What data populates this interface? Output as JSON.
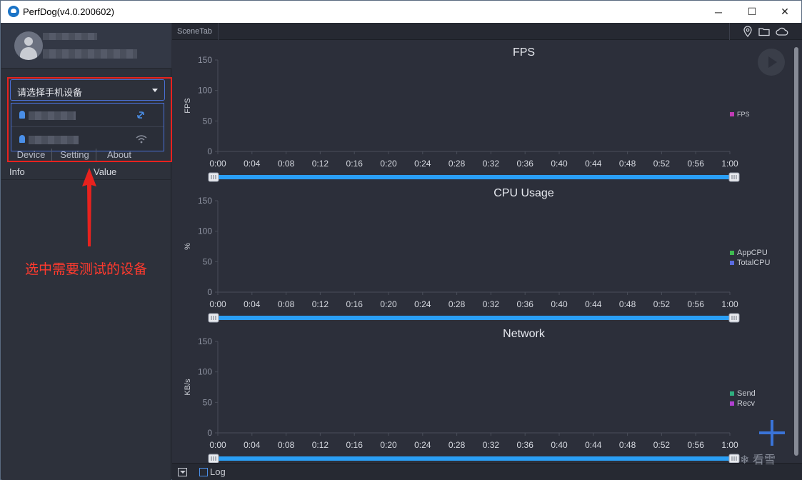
{
  "window": {
    "title": "PerfDog(v4.0.200602)",
    "minimize_glyph": "─",
    "maximize_glyph": "☐",
    "close_glyph": "✕"
  },
  "sidebar": {
    "device_select_placeholder": "请选择手机设备",
    "devices": [
      {
        "connection_icon": "usb-link-icon"
      },
      {
        "connection_icon": "wifi-icon"
      }
    ],
    "tabs": [
      "Device",
      "Setting",
      "About"
    ],
    "info_headers": {
      "info": "Info",
      "value": "Value"
    },
    "annotation": "选中需要测试的设备"
  },
  "scene": {
    "tab_label": "SceneTab",
    "toolbar_icons": [
      "location-pin-icon",
      "folder-icon",
      "cloud-icon"
    ]
  },
  "log": {
    "label": "Log"
  },
  "watermark": "看雪",
  "colors": {
    "accent": "#3a74d8",
    "slider": "#2a9ff5",
    "annotation": "#e8221e"
  },
  "chart_data": [
    {
      "type": "line",
      "title": "FPS",
      "ylabel": "FPS",
      "ylim": [
        0,
        150
      ],
      "yticks": [
        "150",
        "100",
        "50",
        "0"
      ],
      "x": [
        "0:00",
        "0:04",
        "0:08",
        "0:12",
        "0:16",
        "0:20",
        "0:24",
        "0:28",
        "0:32",
        "0:36",
        "0:40",
        "0:44",
        "0:48",
        "0:52",
        "0:56",
        "1:00"
      ],
      "series": [
        {
          "name": "FPS",
          "color": "#c23bb5",
          "values": []
        }
      ],
      "legend": "right"
    },
    {
      "type": "line",
      "title": "CPU Usage",
      "ylabel": "%",
      "ylim": [
        0,
        150
      ],
      "yticks": [
        "150",
        "100",
        "50",
        "0"
      ],
      "x": [
        "0:00",
        "0:04",
        "0:08",
        "0:12",
        "0:16",
        "0:20",
        "0:24",
        "0:28",
        "0:32",
        "0:36",
        "0:40",
        "0:44",
        "0:48",
        "0:52",
        "0:56",
        "1:00"
      ],
      "series": [
        {
          "name": "AppCPU",
          "color": "#3fb950",
          "values": []
        },
        {
          "name": "TotalCPU",
          "color": "#5a6be0",
          "values": []
        }
      ],
      "legend": "right"
    },
    {
      "type": "line",
      "title": "Network",
      "ylabel": "KB/s",
      "ylim": [
        0,
        150
      ],
      "yticks": [
        "150",
        "100",
        "50",
        "0"
      ],
      "x": [
        "0:00",
        "0:04",
        "0:08",
        "0:12",
        "0:16",
        "0:20",
        "0:24",
        "0:28",
        "0:32",
        "0:36",
        "0:40",
        "0:44",
        "0:48",
        "0:52",
        "0:56",
        "1:00"
      ],
      "series": [
        {
          "name": "Send",
          "color": "#2faf7f",
          "values": []
        },
        {
          "name": "Recv",
          "color": "#b040d0",
          "values": []
        }
      ],
      "legend": "right"
    }
  ]
}
